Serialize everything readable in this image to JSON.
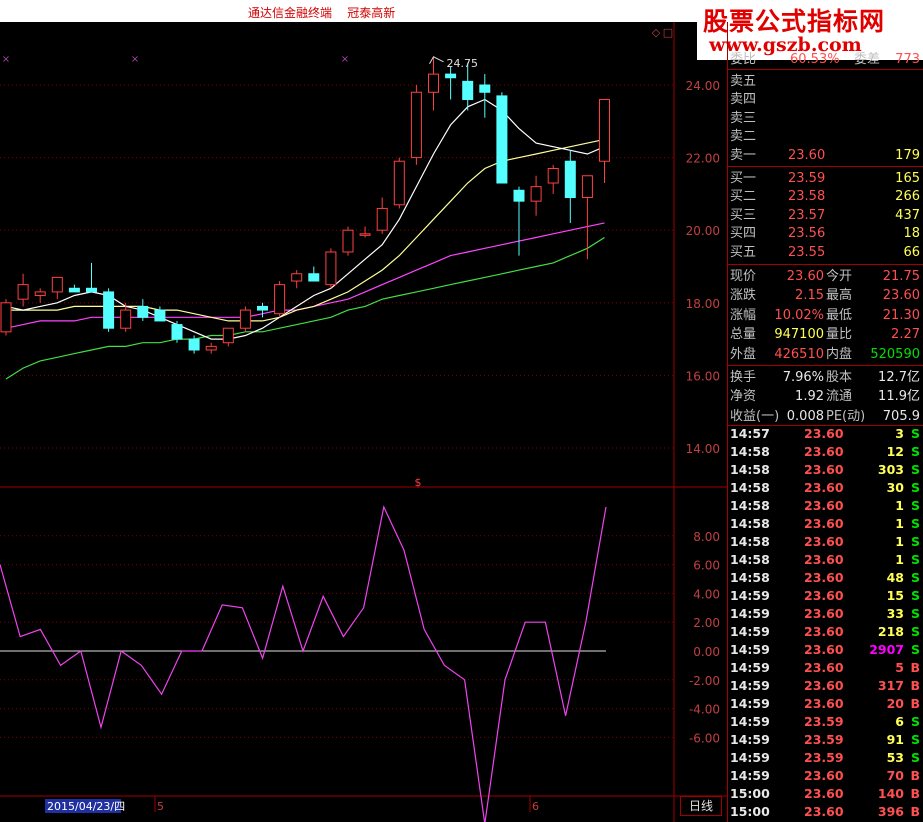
{
  "window": {
    "title": "通达信金融终端    冠泰高新"
  },
  "watermark": {
    "line1": "股票公式指标网",
    "line2": "www.gszb.com"
  },
  "main_chart": {
    "high_label": "24.75",
    "price_axis": [
      "24.00",
      "22.00",
      "20.00",
      "18.00",
      "16.00",
      "14.00"
    ],
    "colors": {
      "up": "#ff4040",
      "down": "#55ffff",
      "ma_short": "#ffffff",
      "ma_mid": "#ffff99",
      "ma_long": "#ff44ff",
      "ma_longest": "#44dd44"
    }
  },
  "indicator": {
    "label": "$",
    "axis": [
      "8.00",
      "6.00",
      "4.00",
      "2.00",
      "0.00",
      "-2.00",
      "-4.00",
      "-6.00"
    ],
    "line_color": "#ee44ee"
  },
  "date_axis": {
    "current_date": "2015/04/23/四",
    "month_5": "5",
    "month_6": "6"
  },
  "timeframe_button": "日线",
  "quote": {
    "weibi_label": "委比",
    "weibi_value": "60.53%",
    "weicha_label": "委差",
    "weicha_value": "773",
    "sell": [
      {
        "label": "卖五",
        "price": "",
        "vol": ""
      },
      {
        "label": "卖四",
        "price": "",
        "vol": ""
      },
      {
        "label": "卖三",
        "price": "",
        "vol": ""
      },
      {
        "label": "卖二",
        "price": "",
        "vol": ""
      },
      {
        "label": "卖一",
        "price": "23.60",
        "vol": "179"
      }
    ],
    "buy": [
      {
        "label": "买一",
        "price": "23.59",
        "vol": "165"
      },
      {
        "label": "买二",
        "price": "23.58",
        "vol": "266"
      },
      {
        "label": "买三",
        "price": "23.57",
        "vol": "437"
      },
      {
        "label": "买四",
        "price": "23.56",
        "vol": "18"
      },
      {
        "label": "买五",
        "price": "23.55",
        "vol": "66"
      }
    ],
    "stats": [
      {
        "l1": "现价",
        "v1": "23.60",
        "l2": "今开",
        "v2": "21.75"
      },
      {
        "l1": "涨跌",
        "v1": "2.15",
        "l2": "最高",
        "v2": "23.60"
      },
      {
        "l1": "涨幅",
        "v1": "10.02%",
        "l2": "最低",
        "v2": "21.30"
      },
      {
        "l1": "总量",
        "v1": "947100",
        "l2": "量比",
        "v2": "2.27"
      },
      {
        "l1": "外盘",
        "v1": "426510",
        "l2": "内盘",
        "v2": "520590"
      }
    ],
    "stats2": [
      {
        "l1": "换手",
        "v1": "7.96%",
        "l2": "股本",
        "v2": "12.7亿"
      },
      {
        "l1": "净资",
        "v1": "1.92",
        "l2": "流通",
        "v2": "11.9亿"
      },
      {
        "l1": "收益(一)",
        "v1": "0.008",
        "l2": "PE(动)",
        "v2": "705.9"
      }
    ]
  },
  "ticks": [
    {
      "time": "14:57",
      "price": "23.60",
      "vol": "3",
      "side": "S"
    },
    {
      "time": "14:58",
      "price": "23.60",
      "vol": "12",
      "side": "S"
    },
    {
      "time": "14:58",
      "price": "23.60",
      "vol": "303",
      "side": "S"
    },
    {
      "time": "14:58",
      "price": "23.60",
      "vol": "30",
      "side": "S"
    },
    {
      "time": "14:58",
      "price": "23.60",
      "vol": "1",
      "side": "S"
    },
    {
      "time": "14:58",
      "price": "23.60",
      "vol": "1",
      "side": "S"
    },
    {
      "time": "14:58",
      "price": "23.60",
      "vol": "1",
      "side": "S"
    },
    {
      "time": "14:58",
      "price": "23.60",
      "vol": "1",
      "side": "S"
    },
    {
      "time": "14:58",
      "price": "23.60",
      "vol": "48",
      "side": "S"
    },
    {
      "time": "14:59",
      "price": "23.60",
      "vol": "15",
      "side": "S"
    },
    {
      "time": "14:59",
      "price": "23.60",
      "vol": "33",
      "side": "S"
    },
    {
      "time": "14:59",
      "price": "23.60",
      "vol": "218",
      "side": "S"
    },
    {
      "time": "14:59",
      "price": "23.60",
      "vol": "2907",
      "side": "S"
    },
    {
      "time": "14:59",
      "price": "23.60",
      "vol": "5",
      "side": "B"
    },
    {
      "time": "14:59",
      "price": "23.60",
      "vol": "317",
      "side": "B"
    },
    {
      "time": "14:59",
      "price": "23.60",
      "vol": "20",
      "side": "B"
    },
    {
      "time": "14:59",
      "price": "23.59",
      "vol": "6",
      "side": "S"
    },
    {
      "time": "14:59",
      "price": "23.59",
      "vol": "91",
      "side": "S"
    },
    {
      "time": "14:59",
      "price": "23.59",
      "vol": "53",
      "side": "S"
    },
    {
      "time": "14:59",
      "price": "23.60",
      "vol": "70",
      "side": "B"
    },
    {
      "time": "15:00",
      "price": "23.60",
      "vol": "140",
      "side": "B"
    },
    {
      "time": "15:00",
      "price": "23.60",
      "vol": "396",
      "side": "B"
    }
  ],
  "chart_data": {
    "type": "candlestick",
    "candles": [
      {
        "o": 17.2,
        "h": 18.1,
        "l": 17.1,
        "c": 18.0
      },
      {
        "o": 18.1,
        "h": 18.8,
        "l": 17.9,
        "c": 18.5
      },
      {
        "o": 18.2,
        "h": 18.4,
        "l": 18.0,
        "c": 18.3
      },
      {
        "o": 18.3,
        "h": 18.6,
        "l": 18.1,
        "c": 18.7
      },
      {
        "o": 18.4,
        "h": 18.5,
        "l": 18.3,
        "c": 18.3
      },
      {
        "o": 18.4,
        "h": 19.1,
        "l": 18.3,
        "c": 18.3
      },
      {
        "o": 18.3,
        "h": 18.4,
        "l": 17.2,
        "c": 17.3
      },
      {
        "o": 17.3,
        "h": 18.0,
        "l": 17.2,
        "c": 17.8
      },
      {
        "o": 17.9,
        "h": 18.1,
        "l": 17.5,
        "c": 17.6
      },
      {
        "o": 17.8,
        "h": 17.9,
        "l": 17.5,
        "c": 17.5
      },
      {
        "o": 17.4,
        "h": 17.5,
        "l": 16.9,
        "c": 17.0
      },
      {
        "o": 17.0,
        "h": 17.1,
        "l": 16.6,
        "c": 16.7
      },
      {
        "o": 16.7,
        "h": 16.9,
        "l": 16.6,
        "c": 16.8
      },
      {
        "o": 16.9,
        "h": 17.3,
        "l": 16.8,
        "c": 17.3
      },
      {
        "o": 17.3,
        "h": 17.9,
        "l": 17.2,
        "c": 17.8
      },
      {
        "o": 17.9,
        "h": 18.0,
        "l": 17.6,
        "c": 17.8
      },
      {
        "o": 17.7,
        "h": 18.6,
        "l": 17.6,
        "c": 18.5
      },
      {
        "o": 18.6,
        "h": 18.9,
        "l": 18.4,
        "c": 18.8
      },
      {
        "o": 18.8,
        "h": 19.0,
        "l": 18.6,
        "c": 18.6
      },
      {
        "o": 18.5,
        "h": 19.5,
        "l": 18.4,
        "c": 19.4
      },
      {
        "o": 19.4,
        "h": 20.1,
        "l": 19.3,
        "c": 20.0
      },
      {
        "o": 19.9,
        "h": 20.1,
        "l": 19.8,
        "c": 19.9
      },
      {
        "o": 20.0,
        "h": 20.9,
        "l": 19.9,
        "c": 20.6
      },
      {
        "o": 20.7,
        "h": 22.0,
        "l": 20.6,
        "c": 21.9
      },
      {
        "o": 22.0,
        "h": 24.0,
        "l": 21.8,
        "c": 23.8
      },
      {
        "o": 23.8,
        "h": 24.75,
        "l": 23.3,
        "c": 24.3
      },
      {
        "o": 24.3,
        "h": 24.5,
        "l": 23.6,
        "c": 24.2
      },
      {
        "o": 24.1,
        "h": 24.6,
        "l": 23.3,
        "c": 23.6
      },
      {
        "o": 24.0,
        "h": 24.3,
        "l": 23.1,
        "c": 23.8
      },
      {
        "o": 23.7,
        "h": 23.8,
        "l": 21.3,
        "c": 21.3
      },
      {
        "o": 21.1,
        "h": 21.2,
        "l": 19.3,
        "c": 20.8
      },
      {
        "o": 20.8,
        "h": 21.5,
        "l": 20.4,
        "c": 21.2
      },
      {
        "o": 21.3,
        "h": 21.8,
        "l": 21.0,
        "c": 21.7
      },
      {
        "o": 21.9,
        "h": 22.2,
        "l": 20.2,
        "c": 20.9
      },
      {
        "o": 20.9,
        "h": 21.5,
        "l": 19.2,
        "c": 21.5
      },
      {
        "o": 21.9,
        "h": 23.1,
        "l": 21.3,
        "c": 23.6
      }
    ],
    "ma_short": [
      17.9,
      17.8,
      17.9,
      18.0,
      18.2,
      18.3,
      18.2,
      17.9,
      17.8,
      17.6,
      17.4,
      17.2,
      17.0,
      17.0,
      17.1,
      17.3,
      17.6,
      17.9,
      18.2,
      18.4,
      18.8,
      19.2,
      19.6,
      20.3,
      21.2,
      22.1,
      22.9,
      23.4,
      23.6,
      23.3,
      22.8,
      22.4,
      22.3,
      22.2,
      22.1,
      22.3
    ],
    "ma_mid": [
      17.8,
      17.8,
      17.8,
      17.8,
      17.9,
      17.9,
      17.9,
      17.9,
      17.9,
      17.8,
      17.8,
      17.7,
      17.6,
      17.5,
      17.5,
      17.5,
      17.6,
      17.8,
      17.9,
      18.1,
      18.3,
      18.6,
      18.9,
      19.3,
      19.8,
      20.3,
      20.8,
      21.3,
      21.7,
      21.9,
      22.0,
      22.1,
      22.2,
      22.3,
      22.4,
      22.5
    ],
    "ma_long": [
      17.3,
      17.4,
      17.5,
      17.5,
      17.5,
      17.6,
      17.6,
      17.6,
      17.6,
      17.6,
      17.6,
      17.6,
      17.6,
      17.6,
      17.6,
      17.7,
      17.8,
      17.8,
      17.9,
      18.0,
      18.1,
      18.3,
      18.5,
      18.7,
      18.9,
      19.1,
      19.3,
      19.4,
      19.5,
      19.6,
      19.7,
      19.8,
      19.9,
      20.0,
      20.1,
      20.2
    ],
    "ma_longest": [
      15.9,
      16.2,
      16.4,
      16.5,
      16.6,
      16.7,
      16.8,
      16.8,
      16.9,
      16.9,
      17.0,
      17.0,
      17.1,
      17.1,
      17.2,
      17.2,
      17.3,
      17.4,
      17.5,
      17.6,
      17.8,
      17.9,
      18.1,
      18.2,
      18.3,
      18.4,
      18.5,
      18.6,
      18.7,
      18.8,
      18.9,
      19.0,
      19.1,
      19.3,
      19.5,
      19.8
    ],
    "indicator_values": [
      6.0,
      1.0,
      1.5,
      -1.0,
      0.0,
      -5.3,
      0.0,
      -1.0,
      -3.0,
      0.0,
      0.0,
      3.2,
      3.0,
      -0.5,
      4.5,
      0.0,
      3.8,
      1.0,
      3.0,
      10.0,
      7.0,
      1.5,
      -1.0,
      -2.0,
      -12.0,
      -2.0,
      2.0,
      2.0,
      -4.5,
      2.0,
      10.0
    ],
    "price_ylim": [
      13.0,
      25.5
    ],
    "indicator_ylim": [
      -13.5,
      11.0
    ]
  }
}
